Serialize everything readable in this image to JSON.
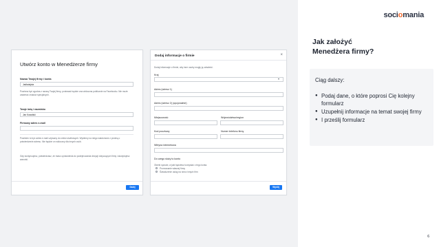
{
  "brand": {
    "logo_before": "soci",
    "logo_o": "o",
    "logo_after": "mania"
  },
  "slide": {
    "heading_line1": "Jak założyć",
    "heading_line2": "Menedżera firmy?",
    "intro": "Ciąg dalszy:",
    "bullets": [
      "Podaj dane, o które poprosi Cię kolejny formularz",
      "Uzupełnij informacje na temat swojej firmy",
      "I prześlij formularz"
    ],
    "page_number": "6"
  },
  "form1": {
    "title": "Utwórz konto w Menedżerze firmy",
    "business_name_label": "Nazwa Twojej firmy i konta",
    "business_name_value": "Jadłodajnia",
    "description": "Powinna być zgodna z nazwą Twojej firmy, ponieważ będzie ona widoczna publicznie na Facebooku. Nie może zawierać znaków specjalnych.",
    "your_name_label": "Twoje imię i nazwisko",
    "your_name_value": "Jan Kowalski",
    "email_label": "Firmowy adres e-mail",
    "email_note": "Powinien to być adres e-mail używany do celów służbowych. Wyślemy na niego wiadomość z prośbą o potwierdzenie adresu. Nie będzie on widoczny dla innych osób.",
    "terms_note": "Gdy kontynuujesz, potwierdzasz, że masz uprawnienia do podejmowania decyzji dotyczących firmy i akceptujesz warunki.",
    "next_button": "Dalej"
  },
  "form2": {
    "title": "Dodaj informacje o firmie",
    "intro": "Dodaj informacje o firmie, aby inne osoby mogły ją odnaleźć.",
    "country_label": "Kraj",
    "address1_label": "Adres (wiersz 1)",
    "address2_label": "Adres (wiersz 2) (opcjonalnie)",
    "city_label": "Miejscowość",
    "state_label": "Województwo/region",
    "postal_label": "Kod pocztowy",
    "phone_label": "Numer telefonu firmy",
    "website_label": "Witryna internetowa",
    "usage_label": "Do czego służy to konto",
    "usage_note": "Określ sposób, w jaki będziesz korzystać z tego konta.",
    "radio1": "Promowanie własnej firmy",
    "radio2": "Świadczenie usług na rzecz innych firm",
    "submit_button": "Wyślij"
  }
}
